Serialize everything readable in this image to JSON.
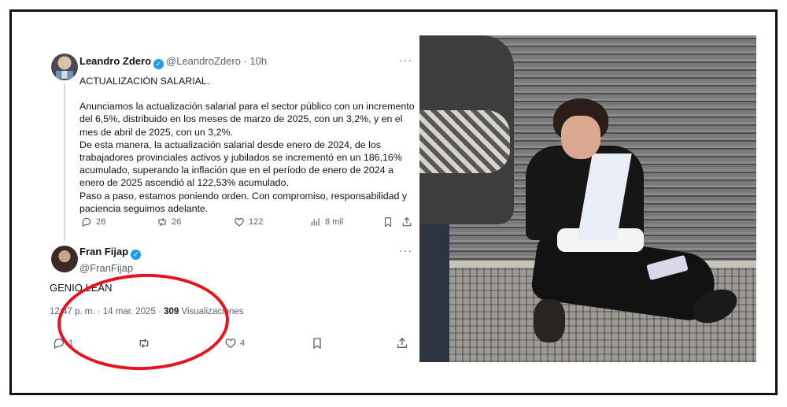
{
  "tweet": {
    "author_name": "Leandro Zdero",
    "author_handle": "@LeandroZdero",
    "time_ago": "10h",
    "more": "···",
    "paragraphs": [
      "ACTUALIZACIÓN SALARIAL.",
      "",
      "Anunciamos la actualización salarial para el sector público con un incremento del 6,5%, distribuido en los meses de marzo de 2025, con un 3,2%, y en el mes de abril de 2025, con un 3,2%.",
      "De esta manera, la actualización salarial desde enero de 2024, de los trabajadores provinciales activos y jubilados se incrementó en un 186,16% acumulado, superando la inflación que en el período de enero de 2024 a enero de 2025 ascendió al 122,53% acumulado.",
      "Paso a paso, estamos poniendo orden. Con compromiso, responsabilidad y paciencia seguimos adelante."
    ],
    "actions": {
      "replies": "28",
      "retweets": "26",
      "likes": "122",
      "views": "8 mil"
    }
  },
  "reply": {
    "author_name": "Fran Fijap",
    "author_handle": "@FranFijap",
    "more": "···",
    "text": "GENIO LEAN",
    "timestamp": "12:47 p. m. · 14 mar. 2025 · ",
    "views_count": "309",
    "views_label": " Visualizaciones",
    "actions": {
      "replies": "1",
      "retweets": "",
      "likes": "4"
    }
  },
  "colors": {
    "verified": "#1d9bf0",
    "highlight_circle": "#e8131b",
    "secondary_text": "#536471"
  },
  "icons": [
    "verified-badge-icon",
    "reply-icon",
    "retweet-icon",
    "like-icon",
    "views-icon",
    "bookmark-icon",
    "share-icon",
    "more-icon"
  ]
}
